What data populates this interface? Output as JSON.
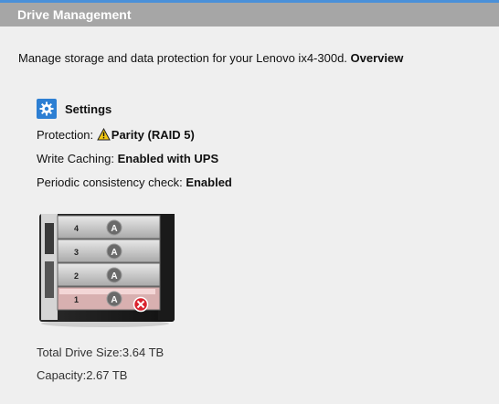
{
  "header": {
    "title": "Drive Management"
  },
  "intro": {
    "text": "Manage storage and data protection for your Lenovo ix4-300d.",
    "link": "Overview"
  },
  "settings": {
    "title": "Settings",
    "protection_label": "Protection:",
    "protection_value": "Parity (RAID 5)",
    "write_caching_label": "Write Caching:",
    "write_caching_value": "Enabled with UPS",
    "consistency_label": "Periodic consistency check:",
    "consistency_value": "Enabled"
  },
  "drives": {
    "bays": [
      {
        "number": "4",
        "badge": "A"
      },
      {
        "number": "3",
        "badge": "A"
      },
      {
        "number": "2",
        "badge": "A"
      },
      {
        "number": "1",
        "badge": "A",
        "status": "failed"
      }
    ]
  },
  "summary": {
    "total_size": "Total Drive Size:3.64 TB",
    "capacity": "Capacity:2.67 TB"
  },
  "colors": {
    "accent": "#2d7fd3",
    "header_bg": "#a6a6a6",
    "error": "#d9232e"
  },
  "icons": [
    "gear-icon",
    "warning-icon",
    "error-x-icon"
  ]
}
